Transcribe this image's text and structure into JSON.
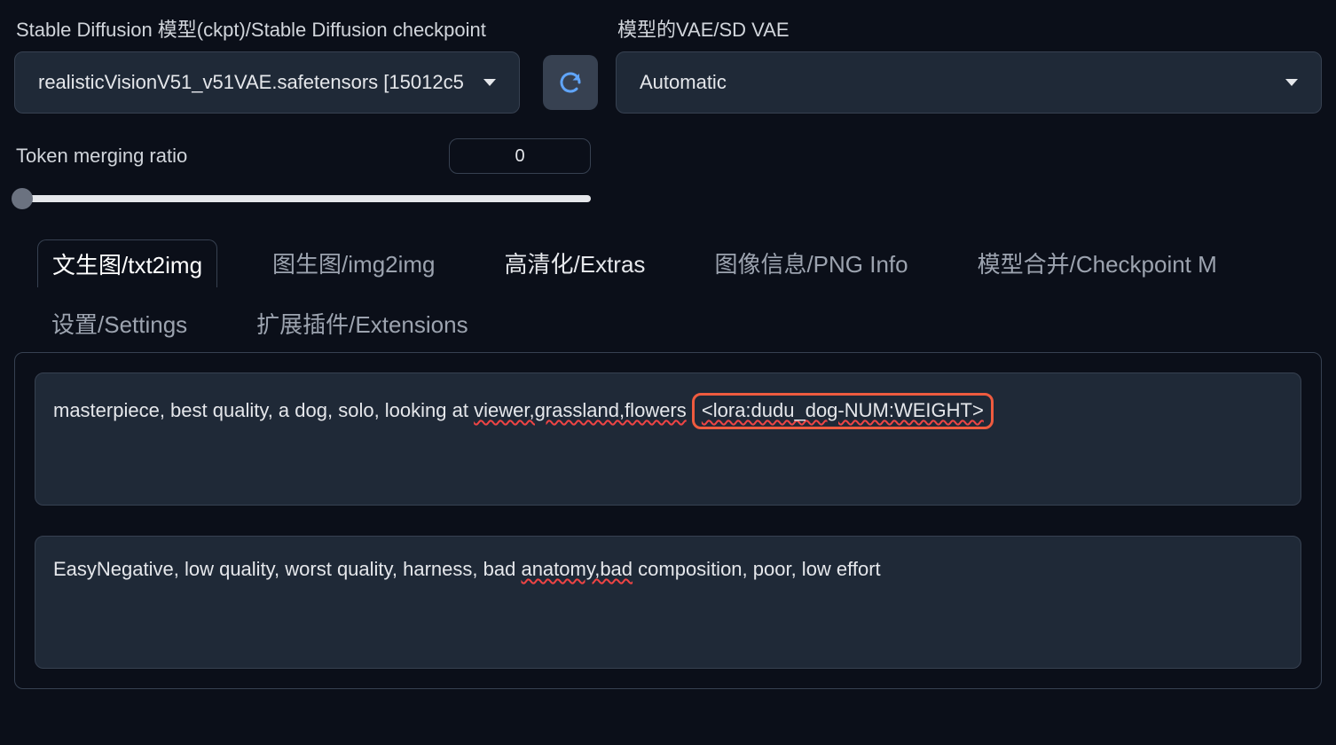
{
  "checkpoint": {
    "label": "Stable Diffusion 模型(ckpt)/Stable Diffusion checkpoint",
    "value": "realisticVisionV51_v51VAE.safetensors [15012c5"
  },
  "vae": {
    "label": "模型的VAE/SD VAE",
    "value": "Automatic"
  },
  "token_merging": {
    "label": "Token merging ratio",
    "value": "0"
  },
  "tabs": {
    "txt2img": "文生图/txt2img",
    "img2img": "图生图/img2img",
    "extras": "高清化/Extras",
    "pnginfo": "图像信息/PNG Info",
    "ckptmerge": "模型合并/Checkpoint M",
    "settings": "设置/Settings",
    "extensions": "扩展插件/Extensions"
  },
  "positive_prompt": {
    "prefix": "masterpiece, best quality, a dog, solo, looking at ",
    "wavy1": "viewer,grassland,flowers",
    "sep": " ",
    "lora_wavy": "<lora:dudu_dog-NUM:WEIGHT>"
  },
  "negative_prompt": {
    "p1": "EasyNegative, low quality, worst quality, harness, bad ",
    "w1": "anatomy,bad",
    "p2": " composition, poor, low effort"
  }
}
